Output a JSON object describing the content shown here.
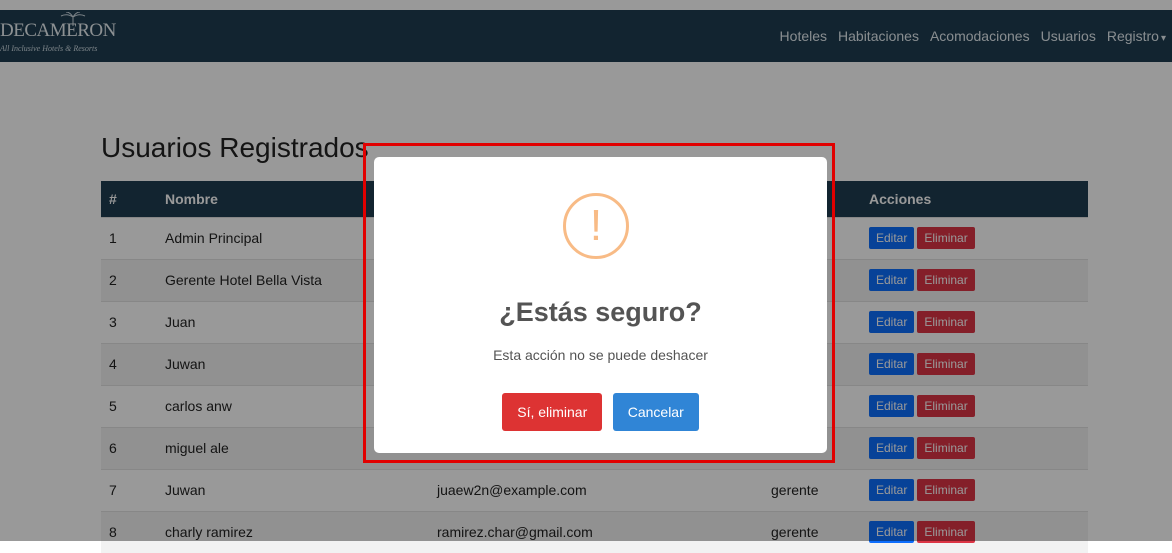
{
  "brand": {
    "name": "DECAMERON",
    "tagline": "All Inclusive Hotels & Resorts"
  },
  "nav": [
    "Hoteles",
    "Habitaciones",
    "Acomodaciones",
    "Usuarios",
    "Registro"
  ],
  "page_title": "Usuarios Registrados",
  "table": {
    "headers": [
      "#",
      "Nombre",
      "",
      "",
      "Acciones"
    ],
    "rows": [
      {
        "num": "1",
        "name": "Admin Principal",
        "email": "",
        "role": ""
      },
      {
        "num": "2",
        "name": "Gerente Hotel Bella Vista",
        "email": "",
        "role": ""
      },
      {
        "num": "3",
        "name": "Juan",
        "email": "",
        "role": ""
      },
      {
        "num": "4",
        "name": "Juwan",
        "email": "",
        "role": ""
      },
      {
        "num": "5",
        "name": "carlos anw",
        "email": "",
        "role": ""
      },
      {
        "num": "6",
        "name": "miguel ale",
        "email": "",
        "role": ""
      },
      {
        "num": "7",
        "name": "Juwan",
        "email": "juaew2n@example.com",
        "role": "gerente"
      },
      {
        "num": "8",
        "name": "charly ramirez",
        "email": "ramirez.char@gmail.com",
        "role": "gerente"
      }
    ],
    "edit_label": "Editar",
    "delete_label": "Eliminar"
  },
  "modal": {
    "icon": "!",
    "title": "¿Estás seguro?",
    "text": "Esta acción no se puede deshacer",
    "confirm_label": "Sí, eliminar",
    "cancel_label": "Cancelar"
  },
  "colors": {
    "navbar": "#1e3d50",
    "edit": "#0d6efd",
    "delete": "#dc3545",
    "confirm": "#dd3333",
    "cancel": "#3085d6",
    "warning": "#f8bb86",
    "highlight": "#e10000"
  }
}
